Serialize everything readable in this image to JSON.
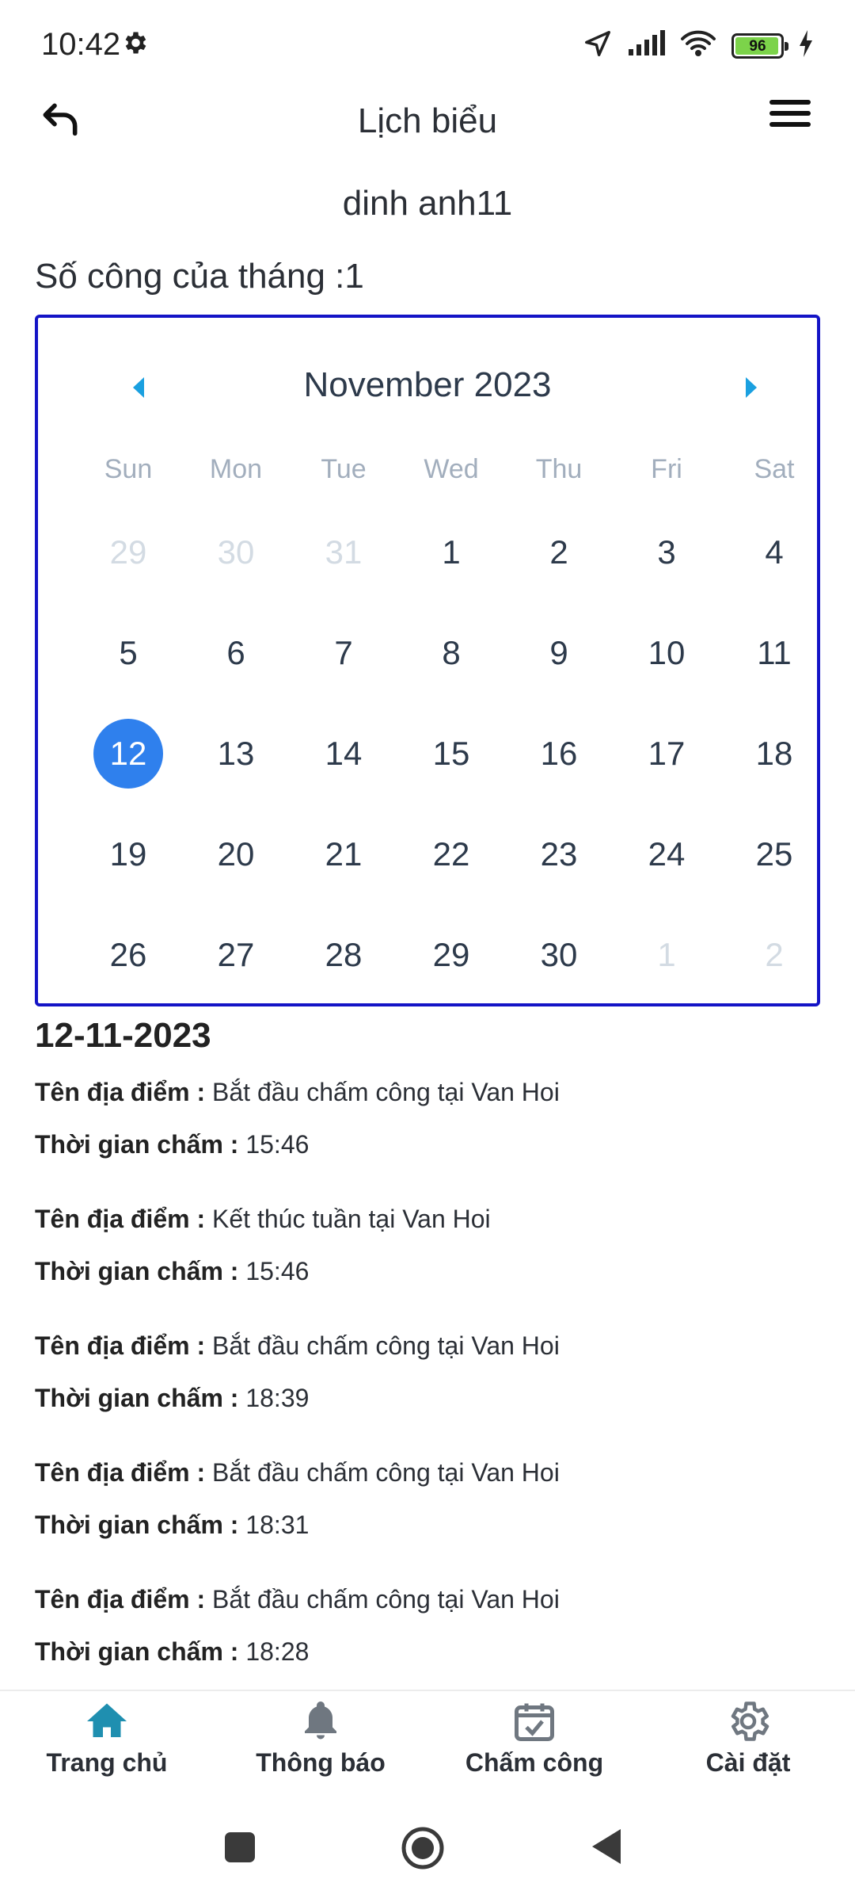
{
  "status": {
    "time": "10:42",
    "battery": "96",
    "battery_level": 0.96
  },
  "header": {
    "title": "Lịch biểu",
    "user_name": "dinh anh11"
  },
  "work_count": "Số công của tháng :1",
  "calendar": {
    "month_label": "November 2023",
    "weekdays": [
      "Sun",
      "Mon",
      "Tue",
      "Wed",
      "Thu",
      "Fri",
      "Sat"
    ],
    "selected_day": "12",
    "weeks": [
      [
        "29",
        "30",
        "31",
        "1",
        "2",
        "3",
        "4"
      ],
      [
        "5",
        "6",
        "7",
        "8",
        "9",
        "10",
        "11"
      ],
      [
        "12",
        "13",
        "14",
        "15",
        "16",
        "17",
        "18"
      ],
      [
        "19",
        "20",
        "21",
        "22",
        "23",
        "24",
        "25"
      ],
      [
        "26",
        "27",
        "28",
        "29",
        "30",
        "1",
        "2"
      ]
    ]
  },
  "details": {
    "date": "12-11-2023",
    "place_label": "Tên địa điểm :",
    "time_label": "Thời gian chấm :",
    "entries": [
      {
        "place": "Bắt đầu chấm công tại Van Hoi",
        "time": "15:46"
      },
      {
        "place": "Kết thúc tuần tại Van Hoi",
        "time": "15:46"
      },
      {
        "place": "Bắt đầu chấm công tại Van Hoi",
        "time": "18:39"
      },
      {
        "place": "Bắt đầu chấm công tại Van Hoi",
        "time": "18:31"
      },
      {
        "place": "Bắt đầu chấm công tại Van Hoi",
        "time": "18:28"
      }
    ]
  },
  "bottom_nav": {
    "items": [
      {
        "label": "Trang chủ",
        "icon": "home-icon",
        "active": true
      },
      {
        "label": "Thông báo",
        "icon": "bell-icon"
      },
      {
        "label": "Chấm công",
        "icon": "calendar-check-icon"
      },
      {
        "label": "Cài đặt",
        "icon": "gear-icon"
      }
    ]
  },
  "colors": {
    "accent": "#2f80ed",
    "calendar_border": "#1414c6",
    "nav_active": "#1f8fb0",
    "nav_inactive": "#6f7780",
    "arrow": "#1aa0e0"
  }
}
